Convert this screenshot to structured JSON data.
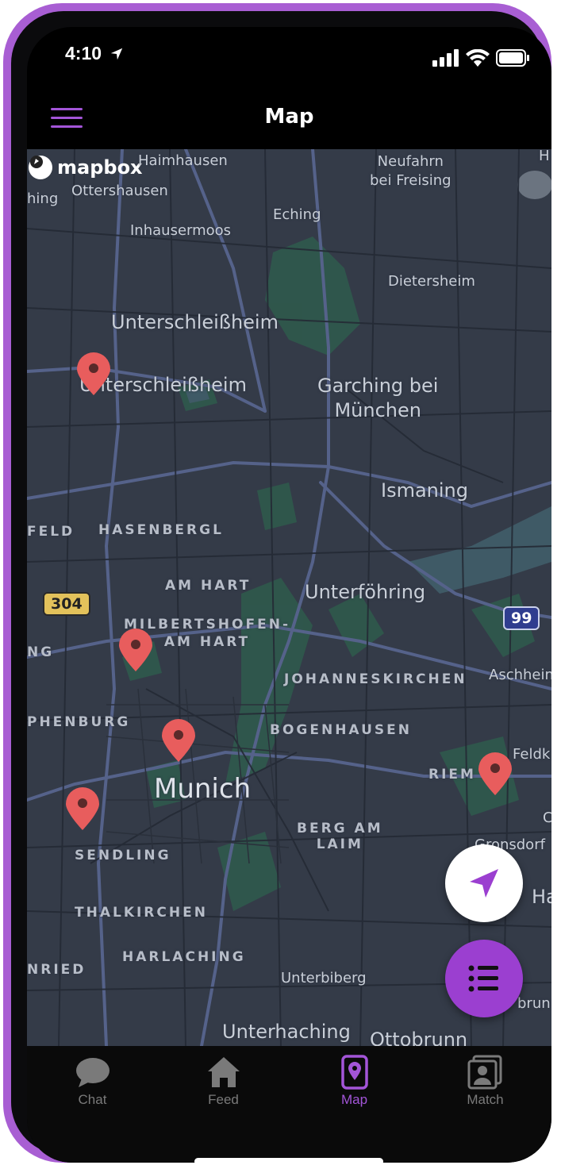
{
  "status_bar": {
    "time": "4:10"
  },
  "app_bar": {
    "title": "Map"
  },
  "map": {
    "logo_text": "mapbox",
    "labels": {
      "neufahrn": "Neufahrn\nbei Freising",
      "haimhausen": "Haimhausen",
      "ottershausen": "Ottershausen",
      "hing": "hing",
      "eching": "Eching",
      "inhausermoos": "Inhausermoos",
      "dietersheim": "Dietersheim",
      "unterschleissheim_top": "Unterschleißheim",
      "unterschleissheim": "Unterschleißheim",
      "garching": "Garching bei\nMünchen",
      "ismaning": "Ismaning",
      "feld": "FELD",
      "hasenbergl": "HASENBERGL",
      "am_hart": "AM HART",
      "unterfoehring": "Unterföhring",
      "milbertshofen": "MILBERTSHOFEN-\nAM HART",
      "ng": "NG",
      "johanneskirchen": "JOHANNESKIRCHEN",
      "aschheim": "Aschheim",
      "phenburg": "PHENBURG",
      "bogenhausen": "BOGENHAUSEN",
      "feldk": "Feldk",
      "riem": "RIEM",
      "munich": "Munich",
      "berg_am_laim": "BERG AM\nLAIM",
      "gronsdorf": "Gronsdorf",
      "sendling": "SENDLING",
      "thalkirchen": "THALKIRCHEN",
      "ha": "Ha",
      "harlaching": "HARLACHING",
      "nried": "NRIED",
      "unterbiberg": "Unterbiberg",
      "unterhaching": "Unterhaching",
      "ottobrunn": "Ottobrunn",
      "run": "brun",
      "h_edge": "H",
      "c_edge": "C"
    },
    "shields": {
      "b304": "304",
      "a99": "99"
    },
    "colors": {
      "background": "#343b48",
      "roads": "#4e5a78",
      "parks": "#2f5a4c",
      "water": "#3f5a66",
      "pin": "#e85d5d"
    }
  },
  "fabs": {
    "locate_icon": "navigation-arrow-icon",
    "list_icon": "list-icon"
  },
  "tabs": [
    {
      "label": "Chat",
      "icon": "chat-bubble-icon",
      "active": false
    },
    {
      "label": "Feed",
      "icon": "home-icon",
      "active": false
    },
    {
      "label": "Map",
      "icon": "map-pin-icon",
      "active": true
    },
    {
      "label": "Match",
      "icon": "contact-card-icon",
      "active": false
    }
  ],
  "colors": {
    "accent": "#a355d8",
    "frame": "#a85ed3"
  }
}
